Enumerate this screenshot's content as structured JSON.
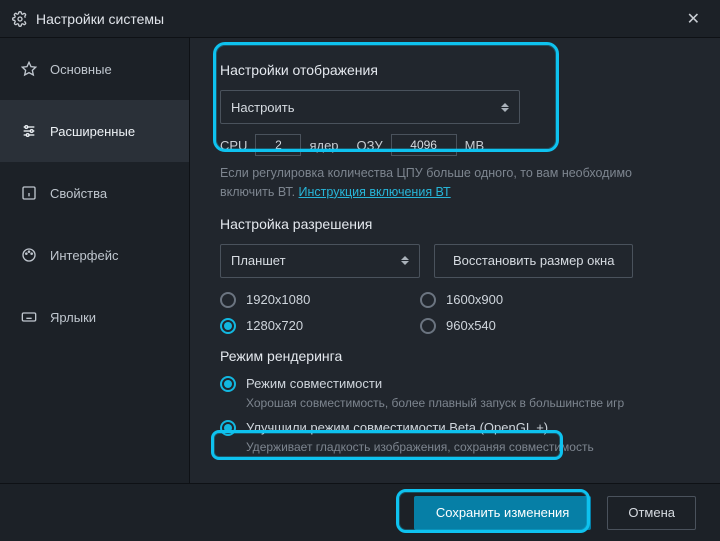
{
  "window": {
    "title": "Настройки системы"
  },
  "sidebar": {
    "items": [
      {
        "label": "Основные"
      },
      {
        "label": "Расширенные"
      },
      {
        "label": "Свойства"
      },
      {
        "label": "Интерфейс"
      },
      {
        "label": "Ярлыки"
      }
    ]
  },
  "display": {
    "heading": "Настройки отображения",
    "select_value": "Настроить",
    "cpu_label": "CPU",
    "cpu_value": "2",
    "cores_label": "ядер",
    "ram_label": "ОЗУ",
    "ram_value": "4096",
    "ram_unit": "MB",
    "hint_pre": "Если регулировка количества ЦПУ больше одного, то вам необходимо включить ВТ. ",
    "hint_link": "Инструкция включения ВТ"
  },
  "resolution": {
    "heading": "Настройка разрешения",
    "select_value": "Планшет",
    "reset_btn": "Восстановить размер окна",
    "options": [
      "1920x1080",
      "1600x900",
      "1280x720",
      "960x540"
    ],
    "selected": "1280x720"
  },
  "render": {
    "heading": "Режим рендеринга",
    "opt1": "Режим совместимости",
    "opt1_hint": "Хорошая совместимость, более плавный запуск в большинстве игр",
    "opt2": "Улучшили режим совместимости Beta (OpenGL +)",
    "opt2_hint": "Удерживает гладкость изображения, сохраняя совместимость",
    "selected": "opt1"
  },
  "footer": {
    "save": "Сохранить изменения",
    "cancel": "Отмена"
  }
}
